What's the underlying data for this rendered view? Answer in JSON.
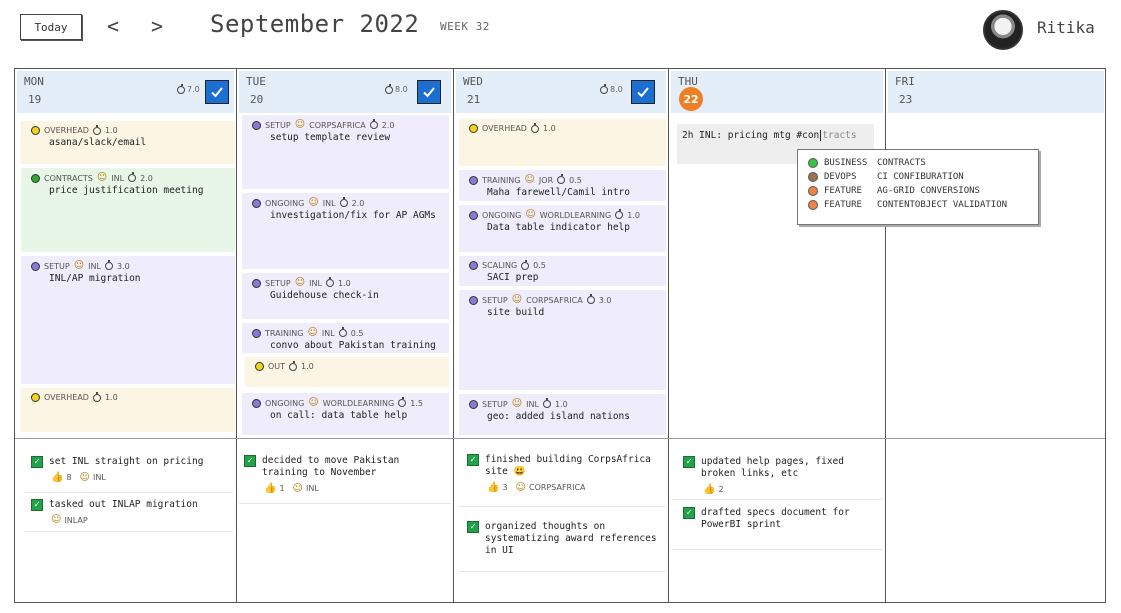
{
  "header": {
    "today_label": "Today",
    "prev_label": "<",
    "next_label": ">",
    "month_title": "September 2022",
    "week_label": "WEEK 32",
    "user_name": "Ritika"
  },
  "days": [
    {
      "name": "MON",
      "num": "19",
      "hours": "7.0",
      "checked": true
    },
    {
      "name": "TUE",
      "num": "20",
      "hours": "8.0",
      "checked": true
    },
    {
      "name": "WED",
      "num": "21",
      "hours": "8.0",
      "checked": true
    },
    {
      "name": "THU",
      "num": "22",
      "hours": "",
      "checked": false,
      "is_today": true
    },
    {
      "name": "FRI",
      "num": "23",
      "hours": "",
      "checked": false
    }
  ],
  "events": {
    "mon": [
      {
        "category": "OVERHEAD",
        "client": "",
        "hours": "1.0",
        "title": "asana/slack/email",
        "dot": "#f4d21c"
      },
      {
        "category": "CONTRACTS",
        "client": "INL",
        "hours": "2.0",
        "title": "price justification meeting",
        "dot": "#2fa832"
      },
      {
        "category": "SETUP",
        "client": "INL",
        "hours": "3.0",
        "title": "INL/AP migration",
        "dot": "#8a78d8"
      },
      {
        "category": "OVERHEAD",
        "client": "",
        "hours": "1.0",
        "title": "",
        "dot": "#f4d21c"
      }
    ],
    "tue": [
      {
        "category": "SETUP",
        "client": "CORPSAFRICA",
        "hours": "2.0",
        "title": "setup template review",
        "dot": "#8a78d8"
      },
      {
        "category": "ONGOING",
        "client": "INL",
        "hours": "2.0",
        "title": "investigation/fix for AP AGMs",
        "dot": "#8a78d8"
      },
      {
        "category": "SETUP",
        "client": "INL",
        "hours": "1.0",
        "title": "Guidehouse check-in",
        "dot": "#8a78d8"
      },
      {
        "category": "TRAINING",
        "client": "INL",
        "hours": "0.5",
        "title": "convo about Pakistan training",
        "dot": "#8a78d8"
      },
      {
        "category": "OUT",
        "client": "",
        "hours": "1.0",
        "title": "",
        "dot": "#f4d21c"
      },
      {
        "category": "ONGOING",
        "client": "WORLDLEARNING",
        "hours": "1.5",
        "title": "on call: data table help",
        "dot": "#8a78d8"
      }
    ],
    "wed": [
      {
        "category": "OVERHEAD",
        "client": "",
        "hours": "1.0",
        "title": "",
        "dot": "#f4d21c"
      },
      {
        "category": "TRAINING",
        "client": "JOR",
        "hours": "0.5",
        "title": "Maha farewell/Camil intro",
        "dot": "#8a78d8"
      },
      {
        "category": "ONGOING",
        "client": "WORLDLEARNING",
        "hours": "1.0",
        "title": "Data table indicator help",
        "dot": "#8a78d8"
      },
      {
        "category": "SCALING",
        "client": "",
        "hours": "0.5",
        "title": "SACI prep",
        "dot": "#8a78d8"
      },
      {
        "category": "SETUP",
        "client": "CORPSAFRICA",
        "hours": "3.0",
        "title": "site build",
        "dot": "#8a78d8"
      },
      {
        "category": "SETUP",
        "client": "INL",
        "hours": "1.0",
        "title": "geo: added island nations",
        "dot": "#8a78d8"
      }
    ]
  },
  "editing": {
    "typed": "2h INL: pricing mtg #con",
    "suggestion_rest": "tracts"
  },
  "tag_suggestions": [
    {
      "category": "BUSINESS",
      "name": "CONTRACTS",
      "color": "#3cbf45"
    },
    {
      "category": "DEVOPS",
      "name": "CI CONFIBURATION",
      "color": "#9a7354"
    },
    {
      "category": "FEATURE",
      "name": "AG-GRID CONVERSIONS",
      "color": "#ee8348"
    },
    {
      "category": "FEATURE",
      "name": "CONTENTOBJECT VALIDATION",
      "color": "#ee8348"
    }
  ],
  "accomplishments": {
    "mon": [
      {
        "text": "set INL straight on pricing",
        "likes": "8",
        "client": "INL"
      },
      {
        "text": "tasked out INLAP migration",
        "likes": "",
        "client": "INLAP"
      }
    ],
    "tue": [
      {
        "text": "decided to move Pakistan training to November",
        "likes": "1",
        "client": "INL"
      }
    ],
    "wed": [
      {
        "text": "finished building CorpsAfrica site 😃",
        "likes": "3",
        "client": "CORPSAFRICA"
      },
      {
        "text": "organized thoughts on systematizing award references in UI",
        "likes": "",
        "client": ""
      }
    ],
    "thu": [
      {
        "text": "updated help pages, fixed broken links, etc",
        "likes": "2",
        "client": ""
      },
      {
        "text": "drafted specs document for PowerBI sprint",
        "likes": "",
        "client": ""
      }
    ]
  },
  "icons": {
    "check": "✓",
    "smiley": "☺",
    "thumbs_up": "👍"
  },
  "colors": {
    "header_bg": "#e3eef8",
    "today_badge": "#f07e22",
    "check_blue": "#1b6fd1",
    "overhead_bg": "#fdf5e3",
    "contracts_bg": "#e8f6e8",
    "work_bg": "#efecfb",
    "done_green": "#22a34a"
  }
}
